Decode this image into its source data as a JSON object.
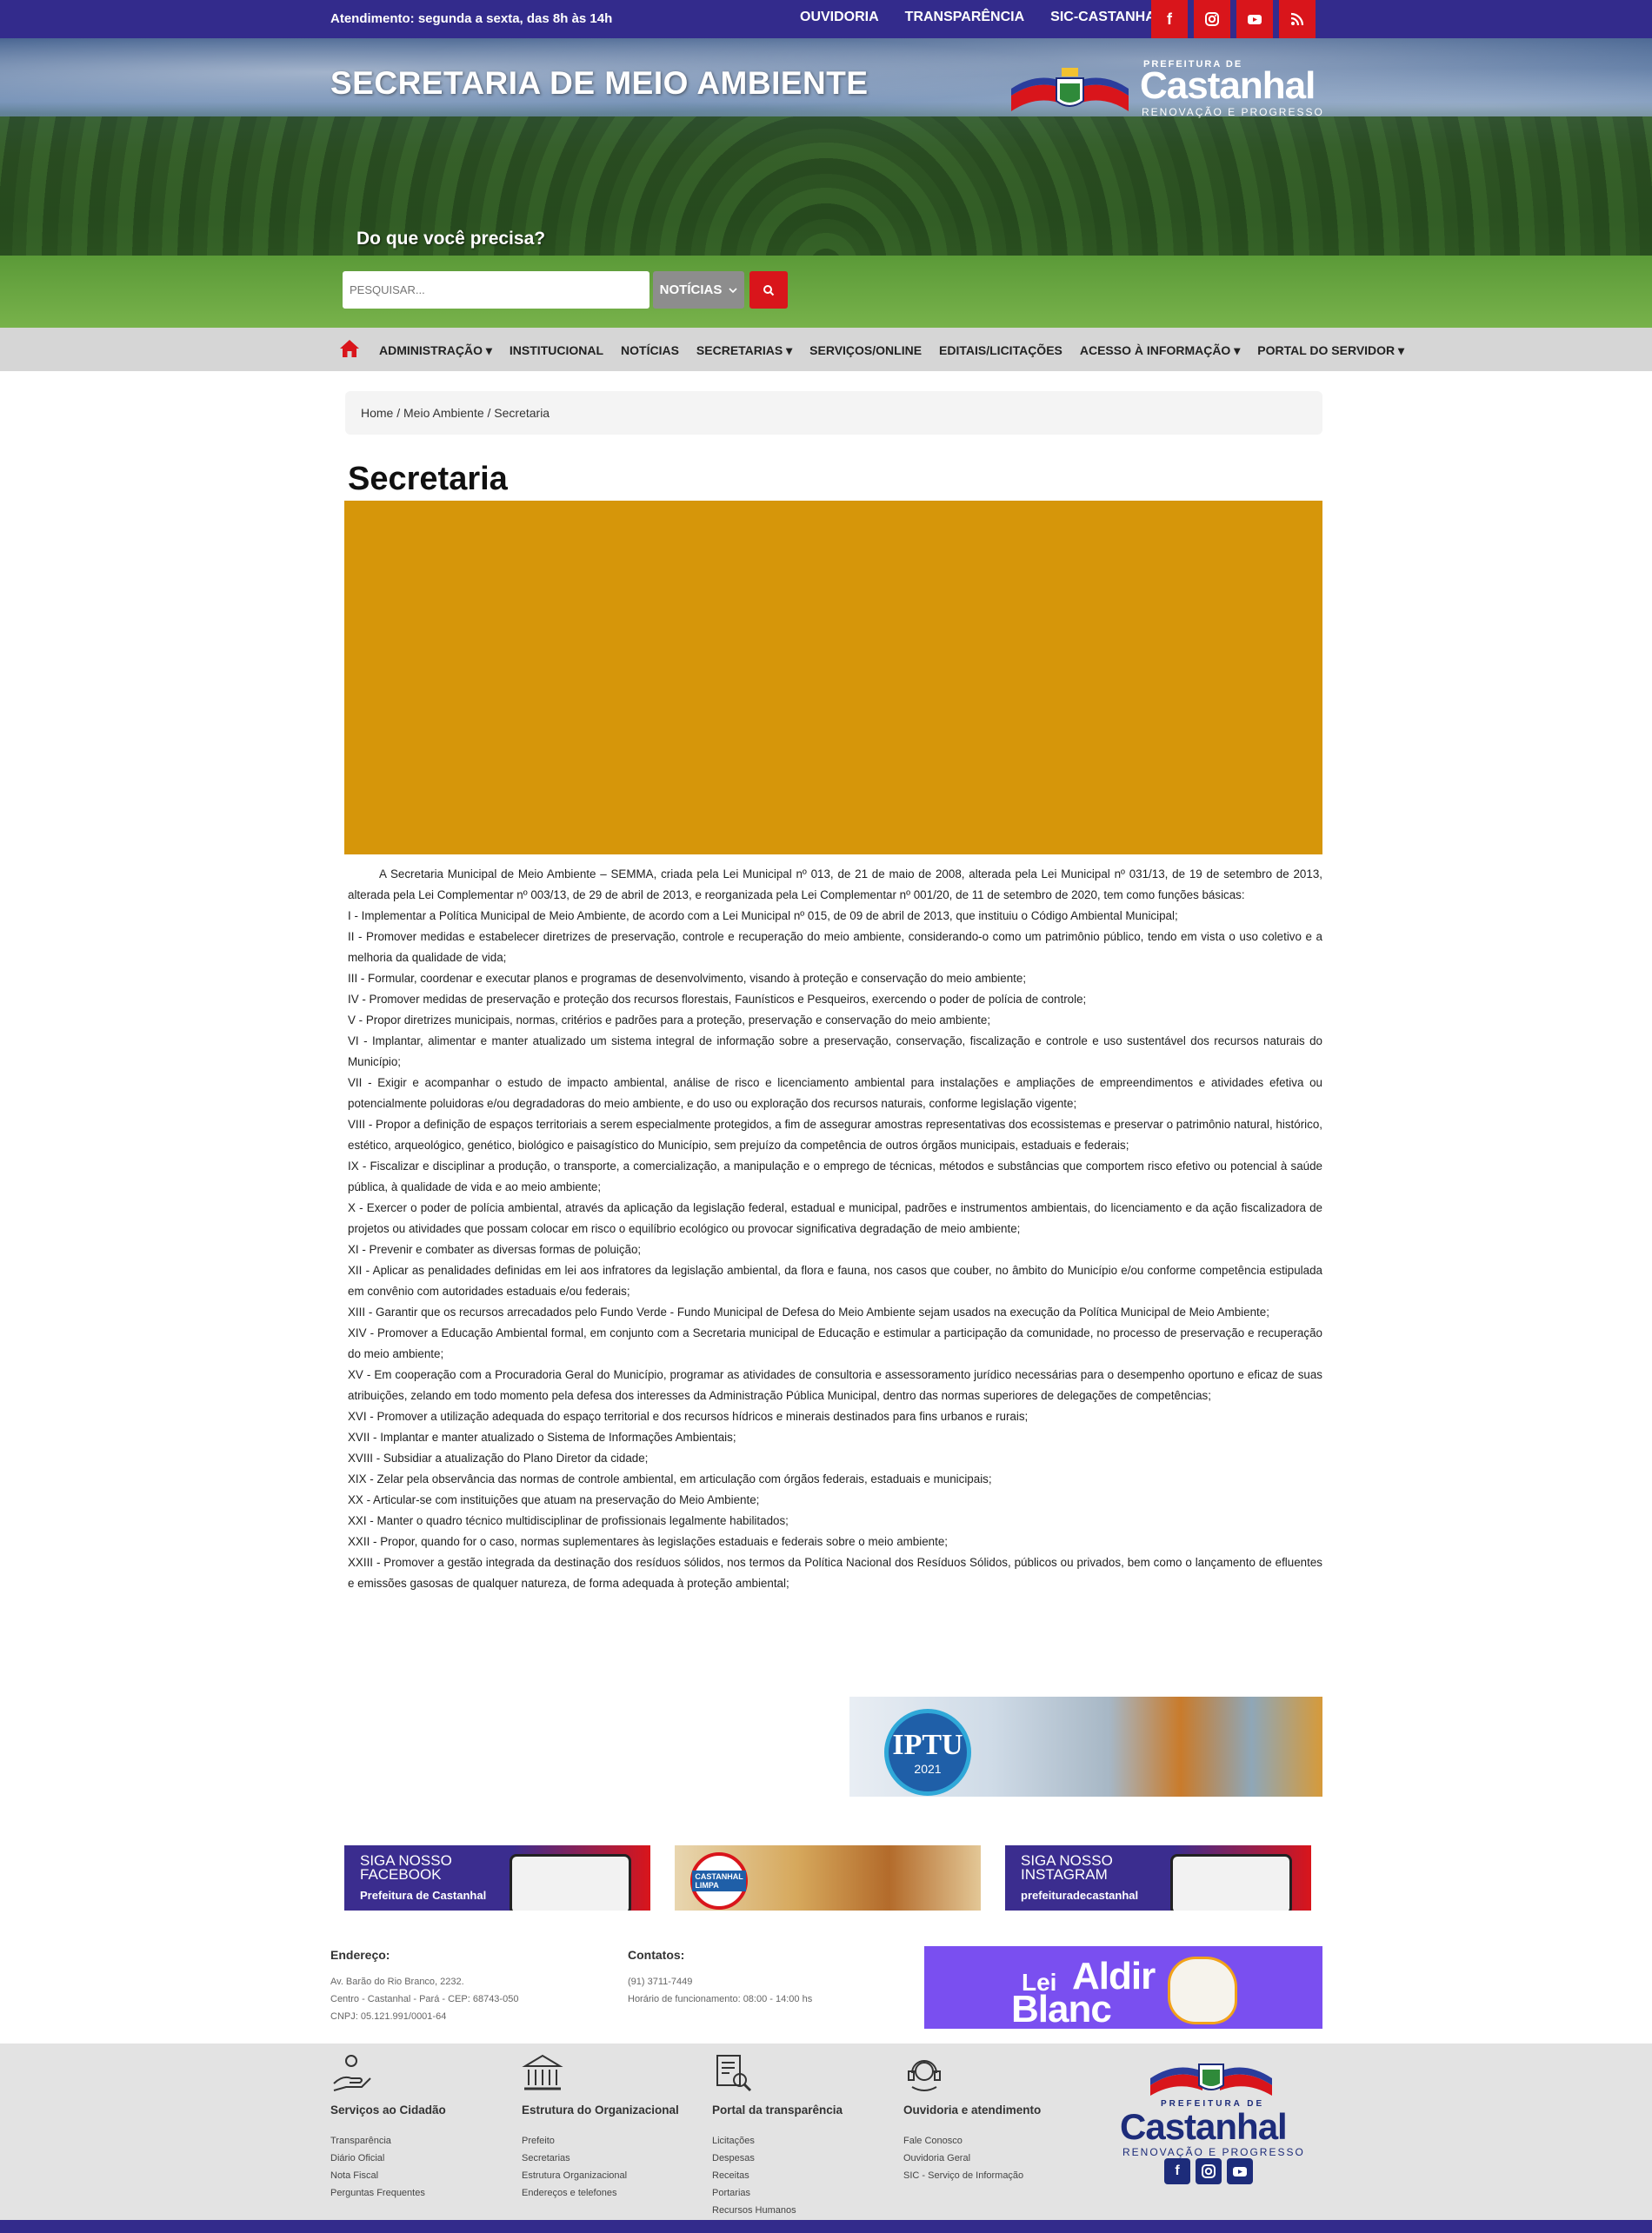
{
  "topbar": {
    "hours": "Atendimento: segunda a sexta, das 8h às 14h",
    "links": [
      "OUVIDORIA",
      "TRANSPARÊNCIA",
      "SIC-CASTANHAL"
    ],
    "social_icons": [
      "facebook-icon",
      "instagram-icon",
      "youtube-icon",
      "rss-icon"
    ]
  },
  "header": {
    "site_title": "SECRETARIA DE MEIO AMBIENTE",
    "logo": {
      "pref": "PREFEITURA DE",
      "name": "Castanhal",
      "slogan": "RENOVAÇÃO E PROGRESSO"
    },
    "search_prompt": "Do que você precisa?",
    "search_placeholder": "PESQUISAR...",
    "search_category": "NOTÍCIAS"
  },
  "nav": {
    "items": [
      "ADMINISTRAÇÃO ▾",
      "INSTITUCIONAL",
      "NOTÍCIAS",
      "SECRETARIAS ▾",
      "SERVIÇOS/ONLINE",
      "EDITAIS/LICITAÇÕES",
      "ACESSO À INFORMAÇÃO ▾",
      "PORTAL DO SERVIDOR ▾"
    ]
  },
  "breadcrumb": "Home  / Meio Ambiente / Secretaria",
  "page_title": "Secretaria",
  "content": {
    "intro": "A Secretaria Municipal de Meio Ambiente – SEMMA, criada pela Lei Municipal nº 013, de 21 de maio de 2008, alterada pela Lei Municipal nº 031/13, de 19 de setembro de 2013, alterada pela Lei Complementar nº 003/13, de 29 de abril de 2013, e reorganizada pela Lei Complementar nº 001/20, de 11 de setembro de 2020, tem como funções básicas:",
    "items": [
      "I - Implementar a Política Municipal de Meio Ambiente, de acordo com a Lei Municipal nº 015, de 09 de abril de 2013, que instituiu o Código Ambiental Municipal;",
      "II - Promover medidas e estabelecer diretrizes de preservação, controle e recuperação do meio ambiente, considerando-o como um patrimônio público, tendo em vista o uso coletivo e a melhoria da qualidade de vida;",
      "III - Formular, coordenar e executar planos e programas de desenvolvimento, visando à proteção e conservação do meio ambiente;",
      "IV - Promover medidas de preservação e proteção dos recursos florestais, Faunísticos e Pesqueiros, exercendo o poder de polícia de controle;",
      "V - Propor diretrizes municipais, normas, critérios e padrões para a proteção, preservação e conservação do meio ambiente;",
      "VI - Implantar, alimentar e manter atualizado um sistema integral de informação sobre a preservação, conservação, fiscalização e controle e uso sustentável dos recursos naturais do Município;",
      "VII - Exigir e acompanhar o estudo de impacto ambiental, análise de risco e licenciamento ambiental para instalações e ampliações de empreendimentos e atividades efetiva ou potencialmente poluidoras e/ou degradadoras do meio ambiente, e do uso ou exploração dos recursos naturais, conforme legislação vigente;",
      "VIII - Propor a definição de espaços territoriais a serem especialmente protegidos, a fim de assegurar amostras representativas dos ecossistemas e preservar o patrimônio natural, histórico, estético, arqueológico, genético, biológico e paisagístico do Município, sem prejuízo da competência de outros órgãos municipais, estaduais e federais;",
      "IX - Fiscalizar e disciplinar a produção, o transporte, a comercialização, a manipulação e o emprego de técnicas, métodos e substâncias que comportem risco efetivo ou potencial à saúde pública, à qualidade de vida e ao meio ambiente;",
      "X - Exercer o poder de polícia ambiental, através da aplicação da legislação federal, estadual e municipal, padrões e instrumentos ambientais, do licenciamento e da ação fiscalizadora de projetos ou atividades que possam colocar em risco o equilíbrio ecológico ou provocar significativa degradação de meio ambiente;",
      "XI - Prevenir e combater as diversas formas de poluição;",
      "XII - Aplicar as penalidades definidas em lei aos infratores da legislação ambiental, da flora e fauna, nos casos que couber, no âmbito do Município e/ou conforme competência estipulada em convênio com autoridades estaduais e/ou federais;",
      "XIII - Garantir que os recursos arrecadados pelo Fundo Verde - Fundo Municipal de Defesa do Meio Ambiente sejam usados na execução da Política Municipal de Meio Ambiente;",
      "XIV - Promover a Educação Ambiental formal, em conjunto com a Secretaria municipal de Educação e estimular a participação da comunidade, no processo de preservação e recuperação do meio ambiente;",
      "XV - Em cooperação com a Procuradoria Geral do Município, programar as atividades de consultoria e assessoramento jurídico necessárias para o desempenho oportuno e eficaz de suas atribuições, zelando em todo momento pela defesa dos interesses da Administração Pública Municipal, dentro das normas superiores de delegações de competências;",
      "XVI - Promover a utilização adequada do espaço territorial e dos recursos hídricos e minerais destinados para fins urbanos e rurais;",
      "XVII - Implantar e manter atualizado o Sistema de Informações Ambientais;",
      "XVIII - Subsidiar a atualização do Plano Diretor da cidade;",
      "XIX - Zelar pela observância das normas de controle ambiental, em articulação com órgãos federais, estaduais e municipais;",
      "XX - Articular-se com instituições que atuam na preservação do Meio Ambiente;",
      "XXI - Manter o quadro técnico multidisciplinar de profissionais legalmente habilitados;",
      "XXII - Propor, quando for o caso, normas suplementares às legislações estaduais e federais sobre o meio ambiente;",
      "XXIII - Promover a gestão integrada da destinação dos resíduos sólidos, nos termos da Política Nacional dos Resíduos Sólidos, públicos ou privados, bem como o lançamento de efluentes e emissões gasosas de qualquer natureza, de forma adequada à proteção ambiental;"
    ]
  },
  "banners": {
    "iptu": {
      "title": "IPTU",
      "year": "2021"
    },
    "facebook": {
      "line1": "SIGA NOSSO",
      "line2": "FACEBOOK",
      "line3": "Prefeitura de Castanhal"
    },
    "castanhal_limpa": "CASTANHAL LIMPA",
    "instagram": {
      "line1": "SIGA NOSSO",
      "line2": "INSTAGRAM",
      "line3": "prefeituradecastanhal"
    },
    "aldir": {
      "lei": "Lei",
      "aldir": "Aldir",
      "blanc": "Blanc"
    }
  },
  "contact": {
    "address_title": "Endereço:",
    "address_lines": [
      "Av. Barão do Rio Branco, 2232.",
      "Centro - Castanhal - Pará - CEP: 68743-050",
      "CNPJ: 05.121.991/0001-64"
    ],
    "contacts_title": "Contatos:",
    "contacts_lines": [
      "(91) 3711-7449",
      "Horário de funcionamento: 08:00 - 14:00 hs"
    ]
  },
  "footer": {
    "columns": [
      {
        "title": "Serviços ao Cidadão",
        "icon": "citizen-hand-icon",
        "links": [
          "Transparência",
          "Diário Oficial",
          "Nota Fiscal",
          "Perguntas Frequentes"
        ]
      },
      {
        "title": "Estrutura do Organizacional",
        "icon": "building-icon",
        "links": [
          "Prefeito",
          "Secretarias",
          "Estrutura Organizacional",
          "Endereços e telefones"
        ]
      },
      {
        "title": "Portal da transparência",
        "icon": "document-search-icon",
        "links": [
          "Licitações",
          "Despesas",
          "Receitas",
          "Portarias",
          "Recursos Humanos"
        ]
      },
      {
        "title": "Ouvidoria e atendimento",
        "icon": "support-headset-icon",
        "links": [
          "Fale Conosco",
          "Ouvidoria Geral",
          "SIC - Serviço de Informação"
        ]
      }
    ],
    "logo": {
      "pref": "PREFEITURA DE",
      "name": "Castanhal",
      "slogan": "RENOVAÇÃO E PROGRESSO"
    }
  },
  "colors": {
    "primary": "#332b8c",
    "accent": "#d9151b",
    "banner": "#d6960a",
    "nav": "#d6d6d6"
  }
}
